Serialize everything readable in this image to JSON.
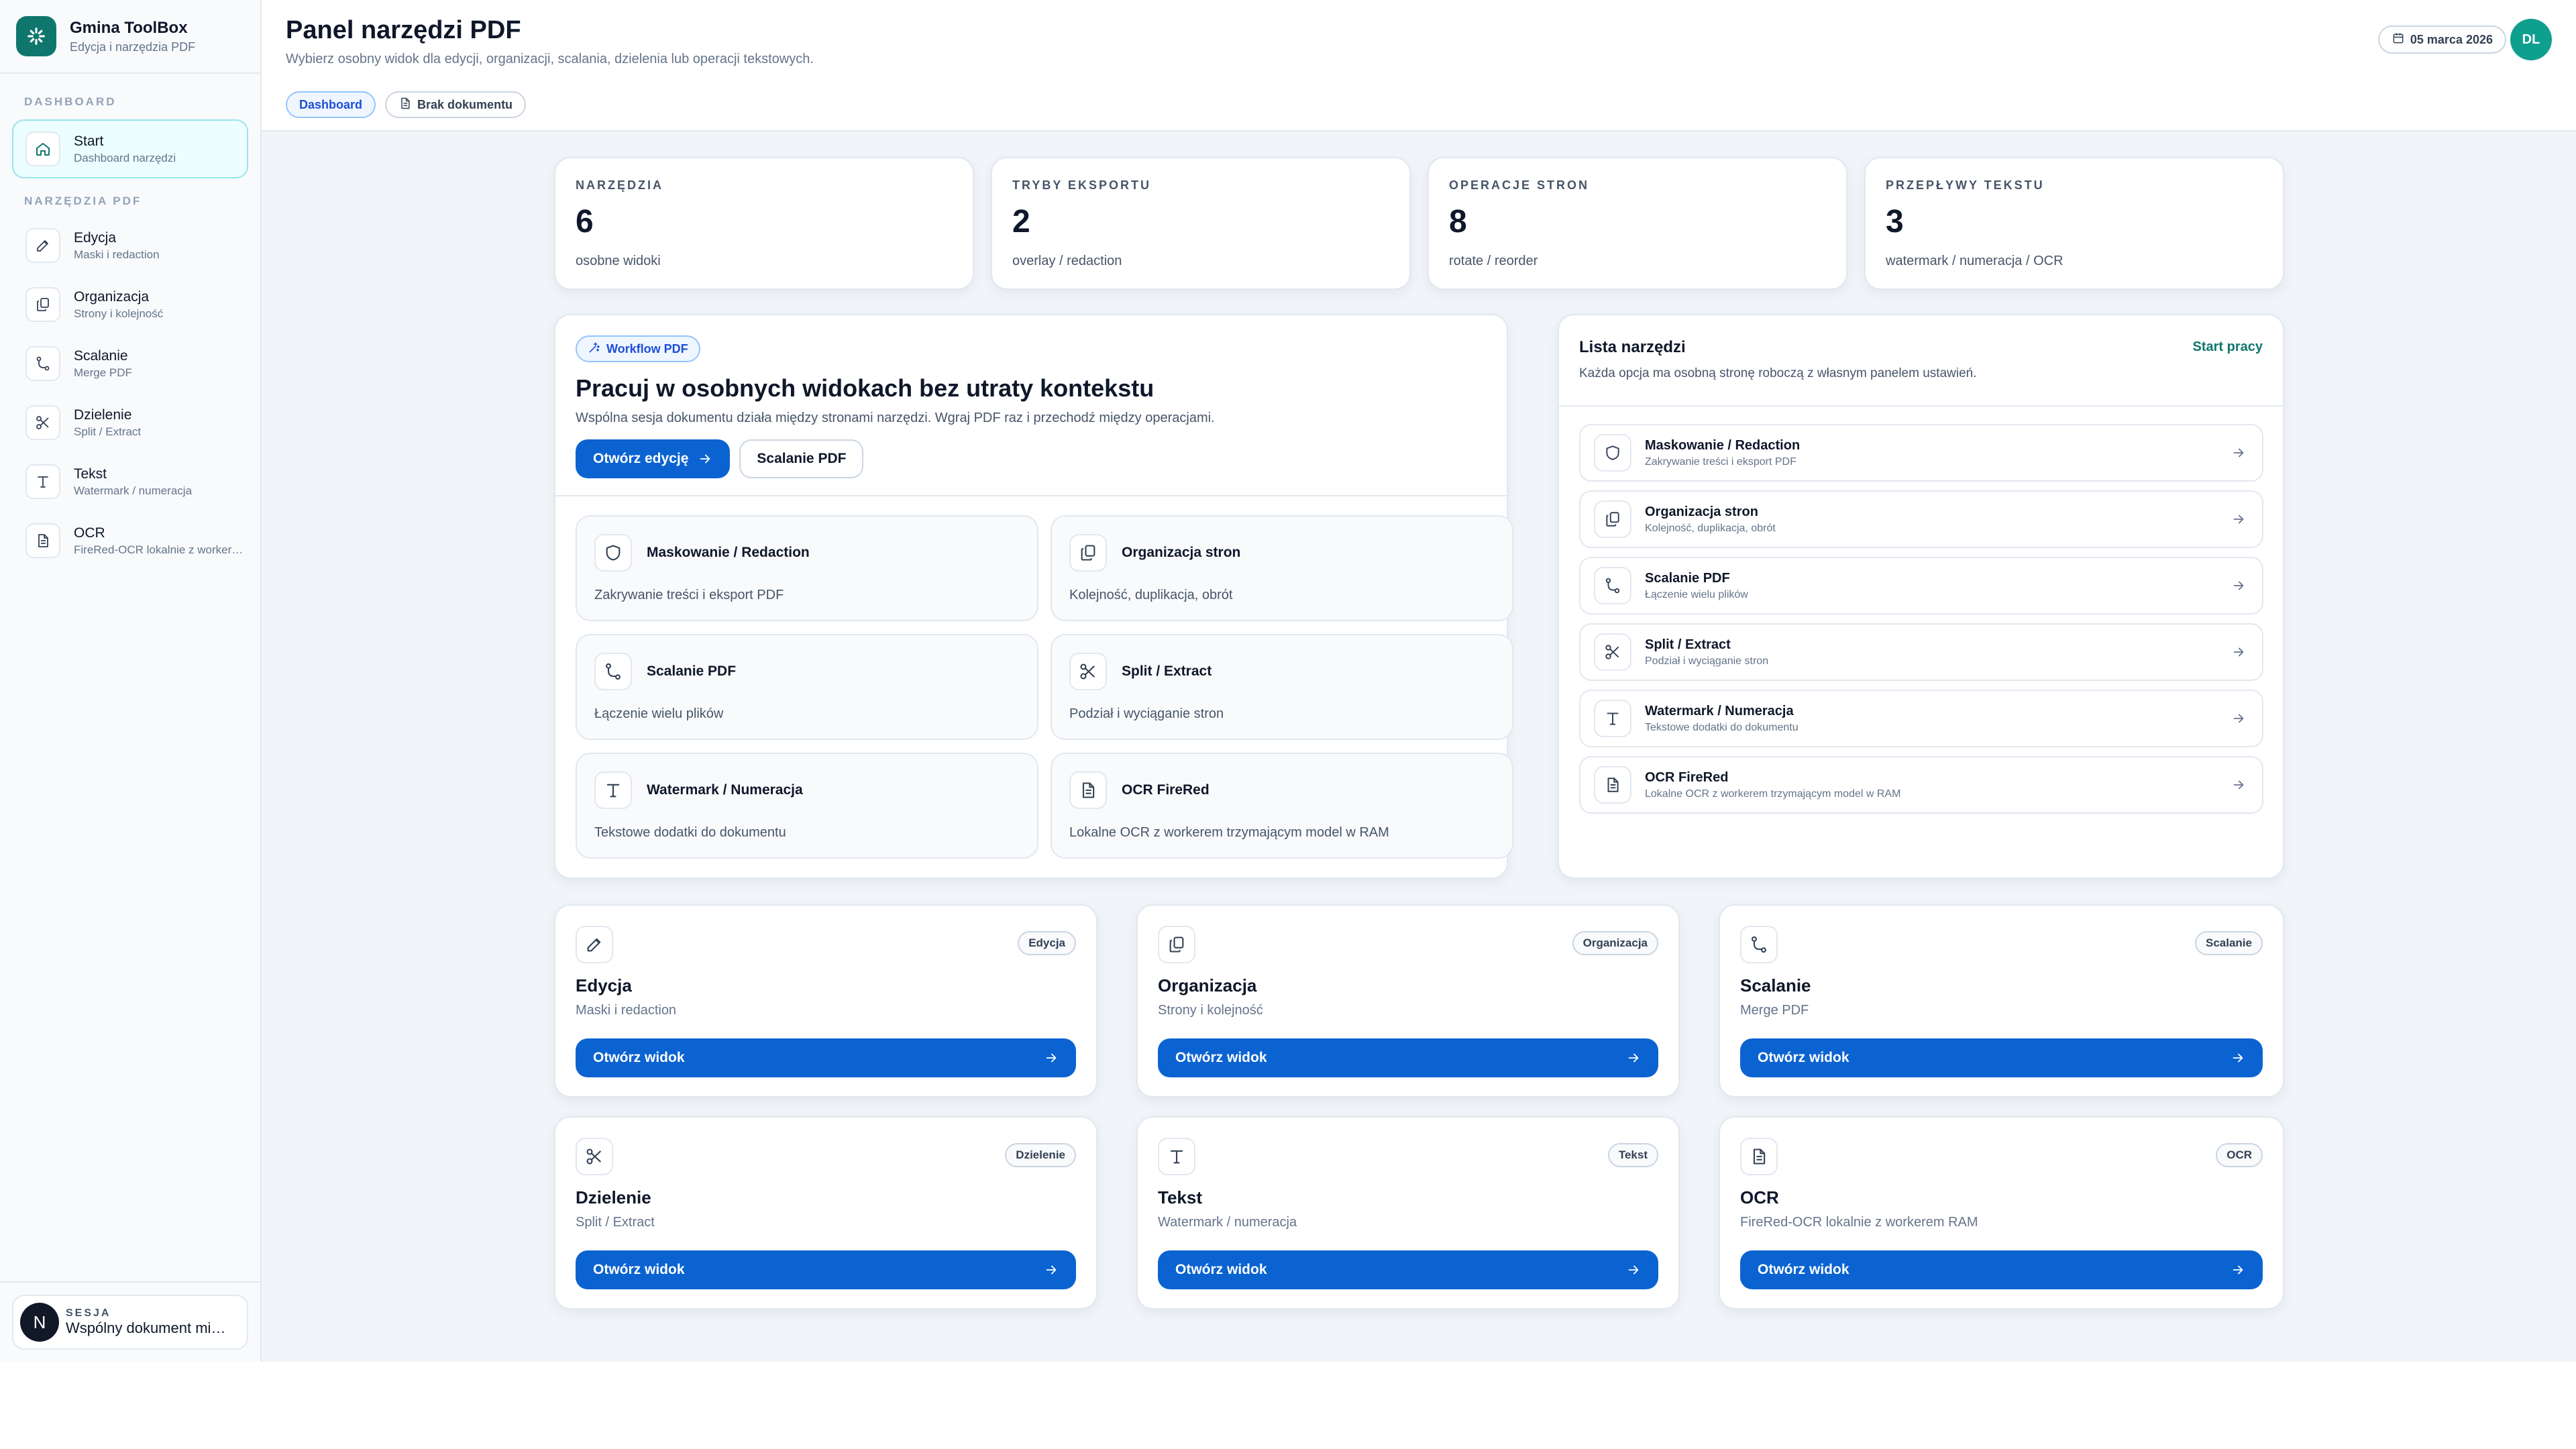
{
  "brand": {
    "title": "Gmina ToolBox",
    "subtitle": "Edycja i narzędzia PDF"
  },
  "sidebar": {
    "section_dashboard": "DASHBOARD",
    "section_tools": "NARZĘDZIA PDF",
    "start": {
      "label": "Start",
      "sub": "Dashboard narzędzi"
    },
    "items": [
      {
        "label": "Edycja",
        "sub": "Maski i redaction",
        "icon": "pencil-icon"
      },
      {
        "label": "Organizacja",
        "sub": "Strony i kolejność",
        "icon": "copy-icon"
      },
      {
        "label": "Scalanie",
        "sub": "Merge PDF",
        "icon": "merge-icon"
      },
      {
        "label": "Dzielenie",
        "sub": "Split / Extract",
        "icon": "scissors-icon"
      },
      {
        "label": "Tekst",
        "sub": "Watermark / numeracja",
        "icon": "text-icon"
      },
      {
        "label": "OCR",
        "sub": "FireRed-OCR lokalnie z workerem RAM",
        "icon": "document-icon"
      }
    ],
    "session": {
      "avatar": "N",
      "label": "SESJA",
      "value": "Wspólny dokument między widokami"
    }
  },
  "header": {
    "title": "Panel narzędzi PDF",
    "subtitle": "Wybierz osobny widok dla edycji, organizacji, scalania, dzielenia lub operacji tekstowych.",
    "pill_dashboard": "Dashboard",
    "pill_doc": "Brak dokumentu",
    "date": "05 marca 2026",
    "avatar": "DL"
  },
  "stats": [
    {
      "label": "NARZĘDZIA",
      "value": "6",
      "sub": "osobne widoki"
    },
    {
      "label": "TRYBY EKSPORTU",
      "value": "2",
      "sub": "overlay / redaction"
    },
    {
      "label": "OPERACJE STRON",
      "value": "8",
      "sub": "rotate / reorder"
    },
    {
      "label": "PRZEPŁYWY TEKSTU",
      "value": "3",
      "sub": "watermark / numeracja / OCR"
    }
  ],
  "workflow": {
    "badge": "Workflow PDF",
    "title": "Pracuj w osobnych widokach bez utraty kontekstu",
    "desc": "Wspólna sesja dokumentu działa między stronami narzędzi. Wgraj PDF raz i przechodź między operacjami.",
    "btn_primary": "Otwórz edycję",
    "btn_secondary": "Scalanie PDF",
    "tiles": [
      {
        "title": "Maskowanie / Redaction",
        "sub": "Zakrywanie treści i eksport PDF"
      },
      {
        "title": "Organizacja stron",
        "sub": "Kolejność, duplikacja, obrót"
      },
      {
        "title": "Scalanie PDF",
        "sub": "Łączenie wielu plików"
      },
      {
        "title": "Split / Extract",
        "sub": "Podział i wyciąganie stron"
      },
      {
        "title": "Watermark / Numeracja",
        "sub": "Tekstowe dodatki do dokumentu"
      },
      {
        "title": "OCR FireRed",
        "sub": "Lokalne OCR z workerem trzymającym model w RAM"
      }
    ]
  },
  "tool_list": {
    "title": "Lista narzędzi",
    "desc": "Każda opcja ma osobną stronę roboczą z własnym panelem ustawień.",
    "link": "Start pracy",
    "items": [
      {
        "title": "Maskowanie / Redaction",
        "sub": "Zakrywanie treści i eksport PDF"
      },
      {
        "title": "Organizacja stron",
        "sub": "Kolejność, duplikacja, obrót"
      },
      {
        "title": "Scalanie PDF",
        "sub": "Łączenie wielu plików"
      },
      {
        "title": "Split / Extract",
        "sub": "Podział i wyciąganie stron"
      },
      {
        "title": "Watermark / Numeracja",
        "sub": "Tekstowe dodatki do dokumentu"
      },
      {
        "title": "OCR FireRed",
        "sub": "Lokalne OCR z workerem trzymającym model w RAM"
      }
    ]
  },
  "views": [
    {
      "tag": "Edycja",
      "title": "Edycja",
      "sub": "Maski i redaction",
      "button": "Otwórz widok"
    },
    {
      "tag": "Organizacja",
      "title": "Organizacja",
      "sub": "Strony i kolejność",
      "button": "Otwórz widok"
    },
    {
      "tag": "Scalanie",
      "title": "Scalanie",
      "sub": "Merge PDF",
      "button": "Otwórz widok"
    },
    {
      "tag": "Dzielenie",
      "title": "Dzielenie",
      "sub": "Split / Extract",
      "button": "Otwórz widok"
    },
    {
      "tag": "Tekst",
      "title": "Tekst",
      "sub": "Watermark / numeracja",
      "button": "Otwórz widok"
    },
    {
      "tag": "OCR",
      "title": "OCR",
      "sub": "FireRed-OCR lokalnie z workerem RAM",
      "button": "Otwórz widok"
    }
  ],
  "colors": {
    "primary": "#0b63d1",
    "brand": "#0f766e",
    "avatar": "#0f9f8f"
  }
}
